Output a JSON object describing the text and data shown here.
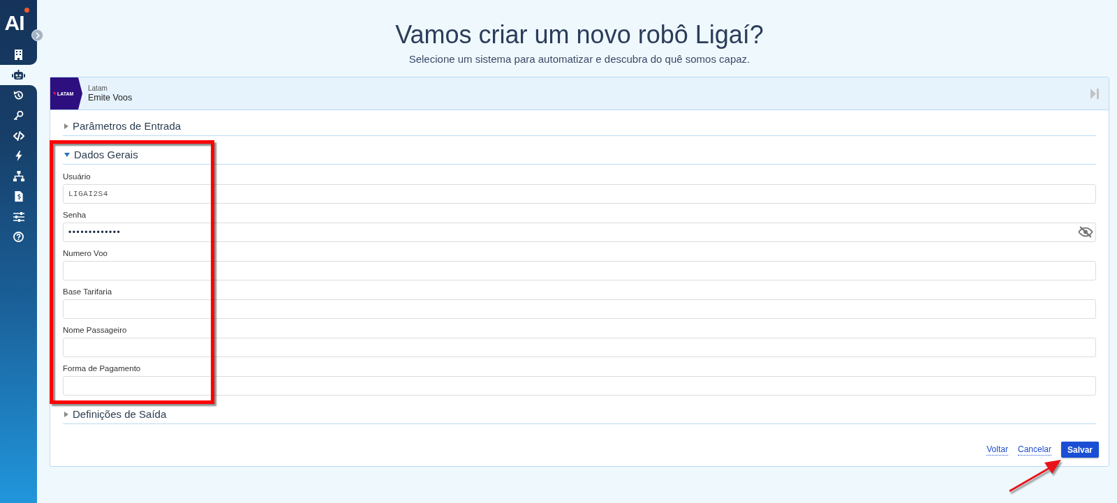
{
  "sidebar": {
    "logo": "AI",
    "items": [
      {
        "selected": false
      },
      {
        "selected": true
      },
      {
        "selected": false
      },
      {
        "selected": false
      },
      {
        "selected": false
      },
      {
        "selected": false
      },
      {
        "selected": false
      },
      {
        "selected": false
      },
      {
        "selected": false
      },
      {
        "selected": false
      }
    ]
  },
  "header": {
    "title": "Vamos criar um novo robô Ligaí?",
    "subtitle": "Selecione um sistema para automatizar e descubra do quê somos capaz."
  },
  "robot_card": {
    "brand": "LATAM",
    "system": "Latam",
    "name": "Emite Voos",
    "sections": [
      {
        "title": "Parâmetros de Entrada",
        "expanded": false
      },
      {
        "title": "Dados Gerais",
        "expanded": true,
        "fields": [
          {
            "label": "Usuário",
            "kind": "text",
            "value": "LIGAI2S4"
          },
          {
            "label": "Senha",
            "kind": "password",
            "value": "•••••••••••••"
          },
          {
            "label": "Numero Voo",
            "kind": "text"
          },
          {
            "label": "Base Tarifaria",
            "kind": "text"
          },
          {
            "label": "Nome Passageiro",
            "kind": "text"
          },
          {
            "label": "Forma de Pagamento",
            "kind": "text"
          }
        ]
      },
      {
        "title": "Definições de Saída",
        "expanded": false
      }
    ],
    "actions": [
      {
        "label": "Voltar",
        "kind": "link"
      },
      {
        "label": "Cancelar",
        "kind": "link"
      },
      {
        "label": "Salvar",
        "kind": "primary"
      }
    ]
  },
  "annotations": {
    "highlight_frame": true,
    "arrow": true
  }
}
